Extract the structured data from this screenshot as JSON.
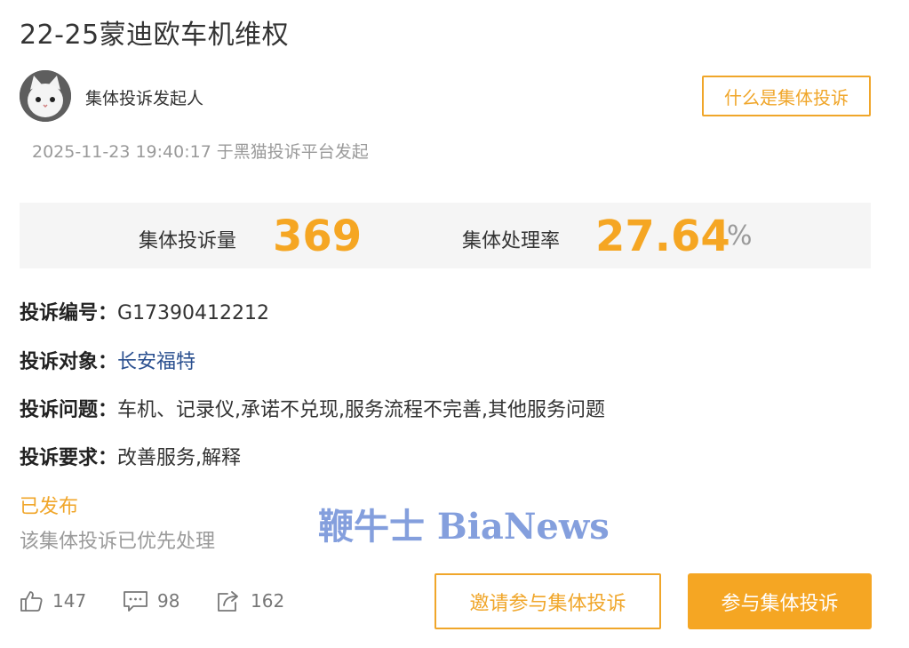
{
  "title": "22-25蒙迪欧车机维权",
  "initiator": {
    "label": "集体投诉发起人",
    "avatar_icon": "cat-avatar-icon"
  },
  "what_button": "什么是集体投诉",
  "meta": {
    "datetime": "2025-11-23 19:40:17",
    "platform_text": "于黑猫投诉平台发起"
  },
  "stats": {
    "count_label": "集体投诉量",
    "count_value": "369",
    "rate_label": "集体处理率",
    "rate_value": "27.64",
    "rate_unit": "%"
  },
  "fields": {
    "id": {
      "key": "投诉编号：",
      "value": "G17390412212"
    },
    "target": {
      "key": "投诉对象：",
      "value": "长安福特"
    },
    "issue": {
      "key": "投诉问题：",
      "value": "车机、记录仪,承诺不兑现,服务流程不完善,其他服务问题"
    },
    "demand": {
      "key": "投诉要求：",
      "value": "改善服务,解释"
    }
  },
  "status": {
    "label": "已发布",
    "note": "该集体投诉已优先处理"
  },
  "watermark": "鞭牛士 BiaNews",
  "actions": {
    "like": {
      "count": "147",
      "icon": "thumbs-up-icon"
    },
    "comment": {
      "count": "98",
      "icon": "comment-icon"
    },
    "share": {
      "count": "162",
      "icon": "share-icon"
    }
  },
  "buttons": {
    "invite": "邀请参与集体投诉",
    "join": "参与集体投诉"
  },
  "colors": {
    "accent": "#f5a623",
    "link": "#2a4f8f",
    "muted": "#9a9a9a"
  }
}
